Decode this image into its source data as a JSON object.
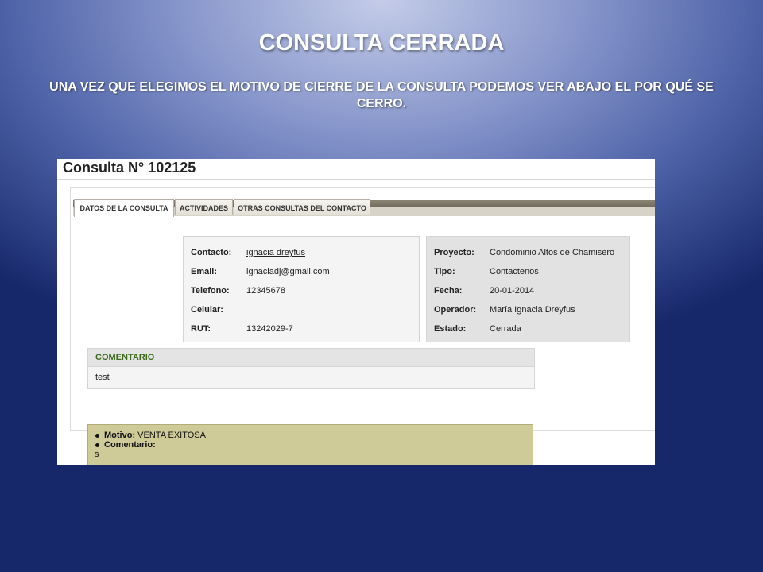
{
  "slide": {
    "title": "CONSULTA CERRADA",
    "subtitle": "UNA VEZ QUE ELEGIMOS EL MOTIVO DE CIERRE DE LA CONSULTA PODEMOS VER ABAJO EL POR QUÉ SE CERRO."
  },
  "consulta": {
    "title": "Consulta N° 102125"
  },
  "tabs": [
    {
      "label": "DATOS DE LA CONSULTA",
      "active": true
    },
    {
      "label": "ACTIVIDADES",
      "active": false
    },
    {
      "label": "OTRAS CONSULTAS DEL CONTACTO",
      "active": false
    }
  ],
  "contact": {
    "contacto_label": "Contacto:",
    "contacto_value": "ignacia dreyfus",
    "email_label": "Email:",
    "email_value": "ignaciadj@gmail.com",
    "telefono_label": "Telefono:",
    "telefono_value": "12345678",
    "celular_label": "Celular:",
    "celular_value": "",
    "rut_label": "RUT:",
    "rut_value": "13242029-7"
  },
  "project": {
    "proyecto_label": "Proyecto:",
    "proyecto_value": "Condominio Altos de Chamisero",
    "tipo_label": "Tipo:",
    "tipo_value": "Contactenos",
    "fecha_label": "Fecha:",
    "fecha_value": "20-01-2014",
    "operador_label": "Operador:",
    "operador_value": "María Ignacia Dreyfus",
    "estado_label": "Estado:",
    "estado_value": "Cerrada"
  },
  "comentario": {
    "header": "COMENTARIO",
    "text": "test"
  },
  "cierre": {
    "motivo_label": "Motivo:",
    "motivo_value": "VENTA EXITOSA",
    "comentario_label": "Comentario:",
    "comentario_value": "s"
  },
  "colors": {
    "comment_header_text": "#3e6b1c",
    "motivo_background": "#cfcb98"
  }
}
